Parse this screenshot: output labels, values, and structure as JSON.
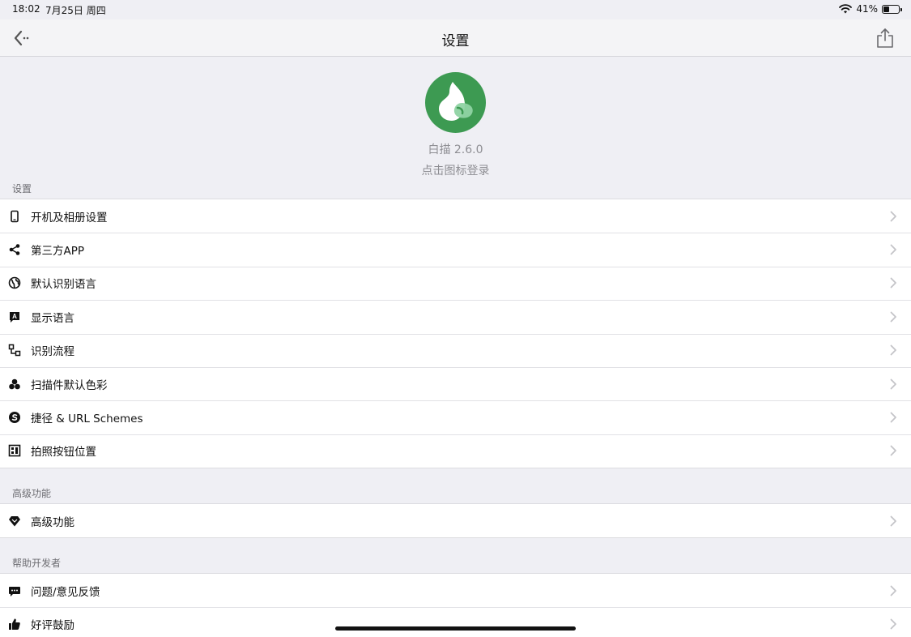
{
  "status_bar": {
    "time": "18:02",
    "date": "7月25日 周四",
    "battery_text": "41%",
    "battery_level": 0.41
  },
  "nav": {
    "title": "设置"
  },
  "header": {
    "app_version": "白描 2.6.0",
    "login_hint": "点击图标登录"
  },
  "sections": {
    "settings": {
      "label": "设置",
      "items": [
        {
          "label": "开机及相册设置",
          "icon": "phone-icon"
        },
        {
          "label": "第三方APP",
          "icon": "share-icon"
        },
        {
          "label": "默认识别语言",
          "icon": "globe-icon"
        },
        {
          "label": "显示语言",
          "icon": "language-icon"
        },
        {
          "label": "识别流程",
          "icon": "flow-icon"
        },
        {
          "label": "扫描件默认色彩",
          "icon": "color-icon"
        },
        {
          "label": "捷径 & URL Schemes",
          "icon": "shortcut-icon"
        },
        {
          "label": "拍照按钮位置",
          "icon": "layout-icon"
        }
      ]
    },
    "advanced": {
      "label": "高级功能",
      "items": [
        {
          "label": "高级功能",
          "icon": "diamond-icon"
        }
      ]
    },
    "help": {
      "label": "帮助开发者",
      "items": [
        {
          "label": "问题/意见反馈",
          "icon": "feedback-icon"
        },
        {
          "label": "好评鼓励",
          "icon": "thumbs-up-icon"
        }
      ]
    }
  },
  "colors": {
    "logo_green": "#3d9a52",
    "background": "#efeff4",
    "chevron": "#c4c4c8"
  }
}
